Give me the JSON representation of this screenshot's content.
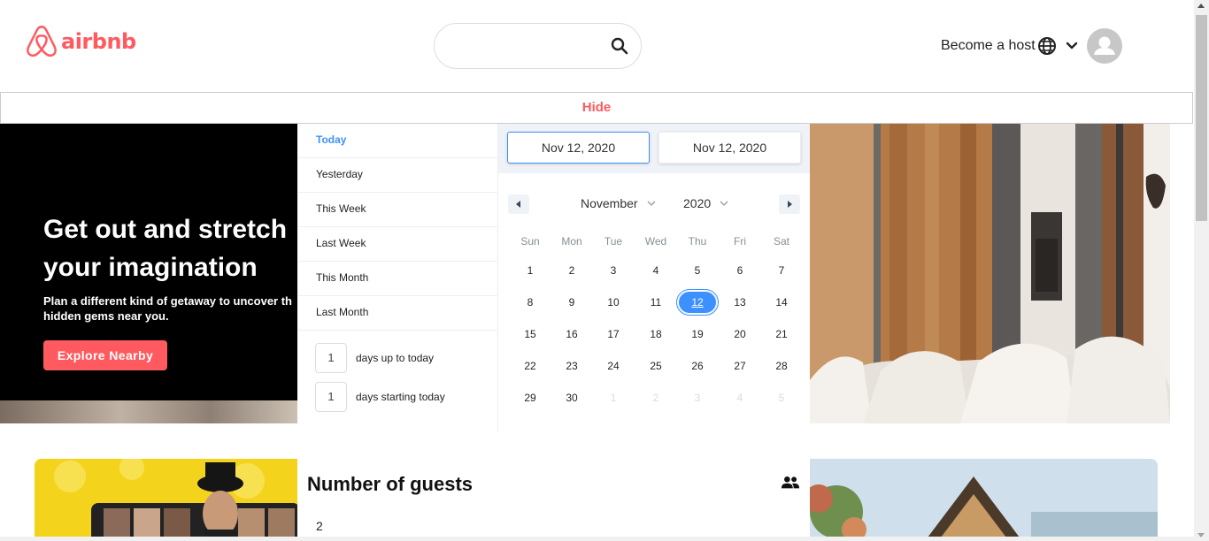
{
  "header": {
    "logo_text": "airbnb",
    "search_placeholder": "",
    "host_label": "Become a host"
  },
  "hide_label": "Hide",
  "hero": {
    "title_line1": "Get out and stretch",
    "title_line2": "your imagination",
    "subtitle_line1": "Plan a different kind of getaway to uncover th",
    "subtitle_line2": "hidden gems near you.",
    "button_label": "Explore Nearby"
  },
  "date_picker": {
    "ranges": [
      "Today",
      "Yesterday",
      "This Week",
      "Last Week",
      "This Month",
      "Last Month"
    ],
    "active_range": "Today",
    "days_up": {
      "value": "1",
      "label": "days up to today"
    },
    "days_starting": {
      "value": "1",
      "label": "days starting today"
    },
    "start_date": "Nov 12, 2020",
    "end_date": "Nov 12, 2020",
    "month": "November",
    "year": "2020",
    "weekdays": [
      "Sun",
      "Mon",
      "Tue",
      "Wed",
      "Thu",
      "Fri",
      "Sat"
    ],
    "weeks": [
      [
        "1",
        "2",
        "3",
        "4",
        "5",
        "6",
        "7"
      ],
      [
        "8",
        "9",
        "10",
        "11",
        "12",
        "13",
        "14"
      ],
      [
        "15",
        "16",
        "17",
        "18",
        "19",
        "20",
        "21"
      ],
      [
        "22",
        "23",
        "24",
        "25",
        "26",
        "27",
        "28"
      ],
      [
        "29",
        "30",
        "1",
        "2",
        "3",
        "4",
        "5"
      ]
    ],
    "selected_day": "12",
    "passive_from_index_last_week": 2
  },
  "guests": {
    "title": "Number of guests",
    "value": "2"
  },
  "colors": {
    "brand": "#FF5A5F",
    "accent": "#3d91ff"
  }
}
